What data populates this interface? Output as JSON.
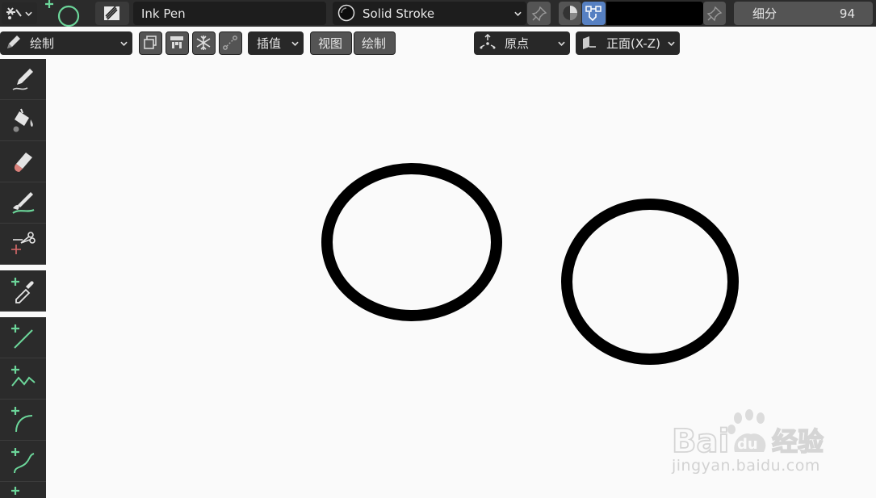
{
  "header": {
    "brush_name": "Ink Pen",
    "material_name": "Solid Stroke",
    "color_hex": "#000000",
    "subdivide_label": "细分",
    "subdivide_value": "94"
  },
  "toolbar2": {
    "mode_label": "绘制",
    "interp_label": "插值",
    "view_label": "视图",
    "draw_label": "绘制",
    "origin_label": "原点",
    "plane_label": "正面(X-Z)"
  },
  "tools": [
    {
      "name": "draw"
    },
    {
      "name": "fill"
    },
    {
      "name": "erase"
    },
    {
      "name": "tint"
    },
    {
      "name": "cutter"
    },
    {
      "name": "eyedropper"
    },
    {
      "name": "line"
    },
    {
      "name": "polyline"
    },
    {
      "name": "arc"
    },
    {
      "name": "curve"
    },
    {
      "name": "box"
    }
  ],
  "canvas": {
    "stroke_color": "#000000"
  },
  "watermark": {
    "logo_text": "Bai  经验",
    "url": "jingyan.baidu.com"
  },
  "colors": {
    "accent": "#5680c2",
    "add_plus": "#6cd69a"
  }
}
